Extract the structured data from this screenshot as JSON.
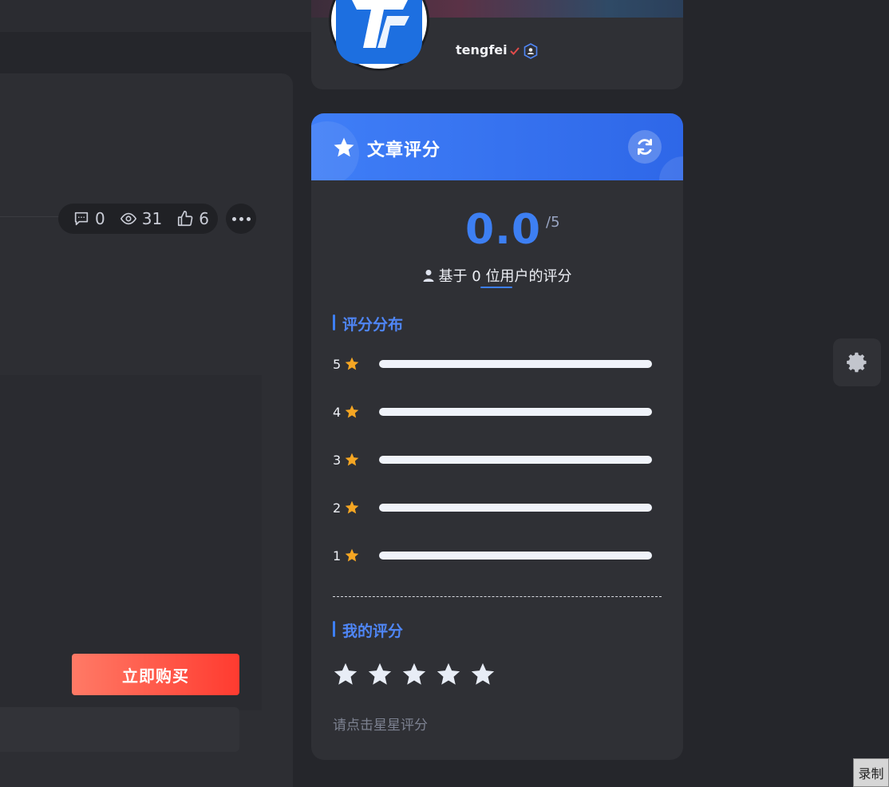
{
  "article": {
    "stats": {
      "comments": "0",
      "views": "31",
      "likes": "6"
    },
    "buy_button_label": "立即购买"
  },
  "profile": {
    "username": "tengfei"
  },
  "rating": {
    "title": "文章评分",
    "score": "0.0",
    "max": "/5",
    "basis_text": "基于 0 位用户的评分",
    "distribution_title": "评分分布",
    "distribution": [
      {
        "stars": "5",
        "fraction": 0
      },
      {
        "stars": "4",
        "fraction": 0
      },
      {
        "stars": "3",
        "fraction": 0
      },
      {
        "stars": "2",
        "fraction": 0
      },
      {
        "stars": "1",
        "fraction": 0
      }
    ],
    "my_rating_title": "我的评分",
    "my_rating_value": 0,
    "hint": "请点击星星评分"
  },
  "colors": {
    "accent": "#3d7ff3",
    "star": "#f5a623",
    "buy": "#ff3b30"
  },
  "floating": {
    "record_label": "录制"
  }
}
